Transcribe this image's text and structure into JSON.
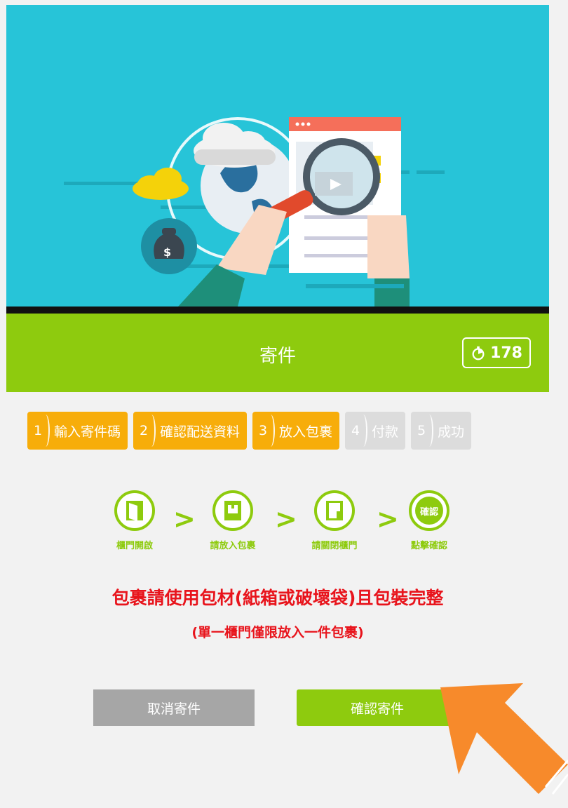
{
  "header": {
    "title": "寄件",
    "timer": "178"
  },
  "steps": [
    {
      "num": "1",
      "label": "輸入寄件碼",
      "state": "active"
    },
    {
      "num": "2",
      "label": "確認配送資料",
      "state": "active"
    },
    {
      "num": "3",
      "label": "放入包裹",
      "state": "active"
    },
    {
      "num": "4",
      "label": "付款",
      "state": "inactive"
    },
    {
      "num": "5",
      "label": "成功",
      "state": "inactive"
    }
  ],
  "flow": [
    {
      "caption": "櫃門開啟",
      "icon": "door-open-icon"
    },
    {
      "caption": "請放入包裹",
      "icon": "package-icon"
    },
    {
      "caption": "請關閉櫃門",
      "icon": "door-close-icon"
    },
    {
      "caption": "點擊確認",
      "icon": "tap-confirm-icon",
      "inner_text": "確認"
    }
  ],
  "notice": {
    "main": "包裹請使用包材(紙箱或破壞袋)且包裝完整",
    "sub": "(單一櫃門僅限放入一件包裹)"
  },
  "buttons": {
    "cancel": "取消寄件",
    "confirm": "確認寄件"
  },
  "colors": {
    "accent": "#8ecb0e",
    "step_active": "#f7ad0a",
    "step_inactive": "#dcdcdc",
    "warning": "#e8141c",
    "hero_bg": "#27c4d8",
    "pointer_arrow": "#f78a2b"
  }
}
